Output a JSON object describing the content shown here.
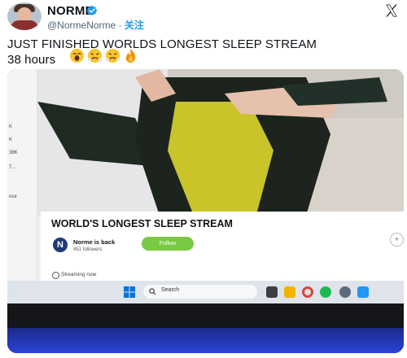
{
  "header": {
    "display_name": "NORME",
    "handle": "@NormeNorme",
    "separator": "·",
    "follow_label": "关注"
  },
  "tweet": {
    "line1": "JUST FINISHED WORLDS LONGEST SLEEP STREAM",
    "line2": "38 hours",
    "emojis": [
      "face-with-open-mouth-emoji",
      "steaming-face-emoji",
      "steaming-face-emoji",
      "fire-emoji"
    ]
  },
  "screen": {
    "left_strip": [
      "K",
      "K",
      "38K",
      "T...",
      "nce"
    ],
    "stream_title": "WORLD'S LONGEST SLEEP STREAM",
    "channel_initial": "N",
    "channel_name": "Norme is back",
    "followers": "451 followers",
    "follow_button": "Follow",
    "status": "Streaming now",
    "plus": "+",
    "taskbar_search": "Search"
  },
  "colors": {
    "follow_green": "#7ac943",
    "link_blue": "#1d9bf0",
    "badge_navy": "#1f3a78"
  }
}
